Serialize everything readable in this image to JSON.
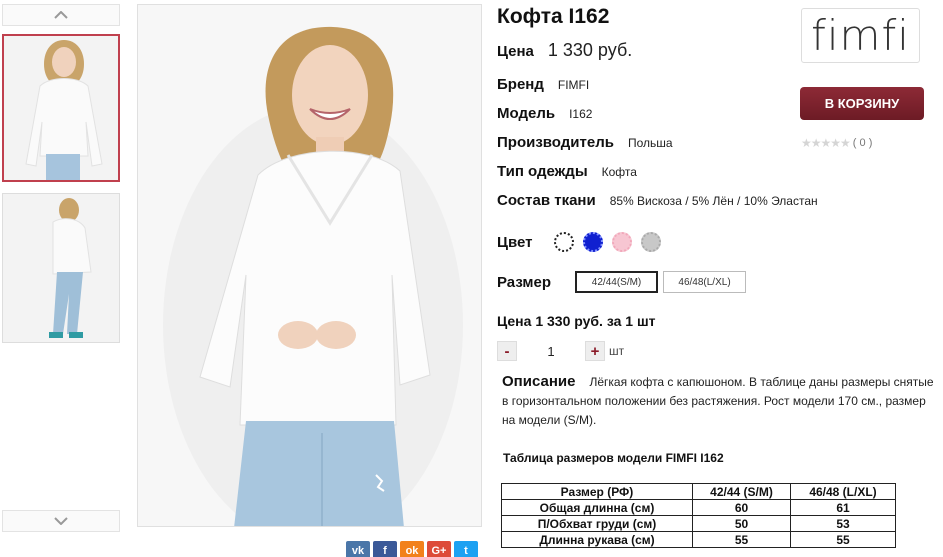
{
  "product": {
    "title": "Кофта I162",
    "price_label": "Цена",
    "price_value": "1 330 руб."
  },
  "props": [
    {
      "label": "Бренд",
      "value": "FIMFI"
    },
    {
      "label": "Модель",
      "value": "I162"
    },
    {
      "label": "Производитель",
      "value": "Польша"
    },
    {
      "label": "Тип одежды",
      "value": "Кофта"
    },
    {
      "label": "Состав ткани",
      "value": "85% Вискоза / 5% Лён / 10% Эластан"
    }
  ],
  "color": {
    "label": "Цвет",
    "swatches": [
      "#ffffff",
      "#1020d0",
      "#f7c6d2",
      "#c8c8c8"
    ]
  },
  "size": {
    "label": "Размер",
    "options": [
      "42/44(S/M)",
      "46/48(L/XL)"
    ],
    "selected": "42/44(S/M)"
  },
  "unit_price": "Цена 1 330 руб. за 1 шт",
  "quantity": {
    "minus": "-",
    "value": "1",
    "plus": "+",
    "unit": "шт"
  },
  "description": {
    "label": "Описание",
    "text": "Лёгкая кофта с капюшоном. В таблице даны размеры снятые в горизонтальном положении без растяжения. Рост модели 170 см., размер на модели (S/M)."
  },
  "size_table": {
    "title": "Таблица размеров модели FIMFI  I162",
    "headers": [
      "Размер (РФ)",
      "42/44 (S/M)",
      "46/48 (L/XL)"
    ],
    "rows": [
      [
        "Общая длинна (см)",
        "60",
        "61"
      ],
      [
        "П/Обхват груди (см)",
        "50",
        "53"
      ],
      [
        "Длинна рукава (см)",
        "55",
        "55"
      ]
    ]
  },
  "brand_logo": "fimfi",
  "cart_button": "В КОРЗИНУ",
  "rating": {
    "stars": "★★★★★",
    "count": "( 0 )"
  },
  "social": [
    {
      "icon": "vk-icon",
      "glyph": "vk",
      "color": "#4a76a8"
    },
    {
      "icon": "facebook-icon",
      "glyph": "f",
      "color": "#3b5998"
    },
    {
      "icon": "odnoklassniki-icon",
      "glyph": "ok",
      "color": "#f2811b"
    },
    {
      "icon": "googleplus-icon",
      "glyph": "G+",
      "color": "#dd4b39"
    },
    {
      "icon": "twitter-icon",
      "glyph": "t",
      "color": "#1da1f2"
    }
  ]
}
